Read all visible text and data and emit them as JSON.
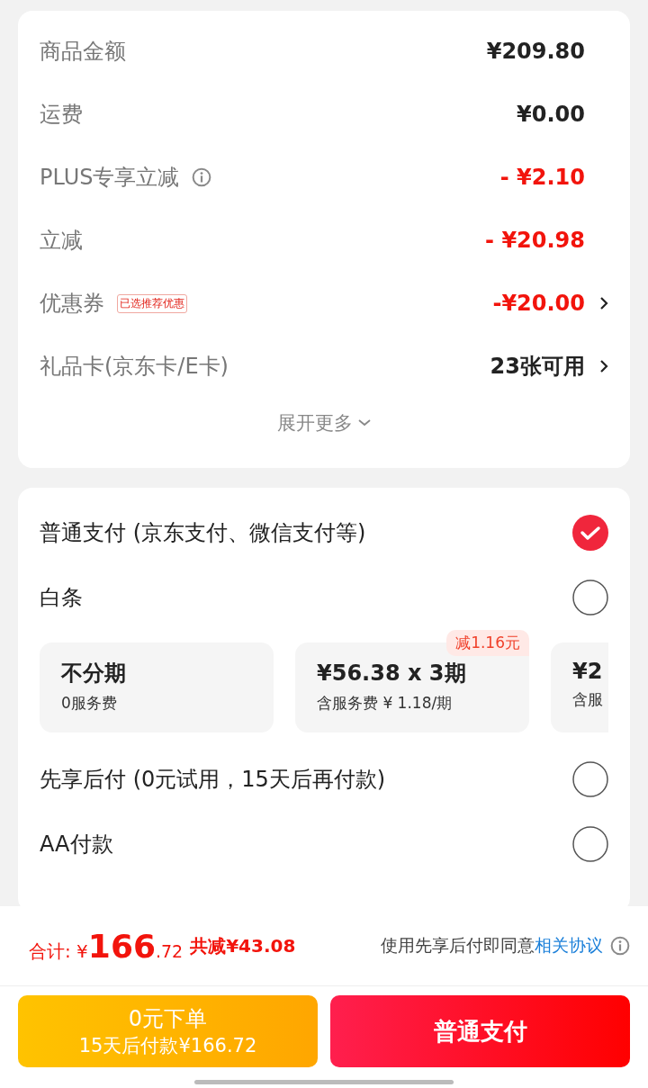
{
  "summary": {
    "rows": [
      {
        "label": "商品金额",
        "value": "¥209.80",
        "kind": "plain",
        "info": false,
        "chevron": false
      },
      {
        "label": "运费",
        "value": "¥0.00",
        "kind": "plain",
        "info": false,
        "chevron": false
      },
      {
        "label": "PLUS专享立减",
        "value": "- ¥2.10",
        "kind": "discount",
        "info": true,
        "chevron": false
      },
      {
        "label": "立减",
        "value": "- ¥20.98",
        "kind": "discount",
        "info": false,
        "chevron": false
      },
      {
        "label": "优惠券",
        "tag": "已选推荐优惠",
        "value": "-¥20.00",
        "kind": "discount",
        "info": false,
        "chevron": true
      },
      {
        "label": "礼品卡(京东卡/E卡)",
        "value": "23张可用",
        "kind": "plain",
        "info": false,
        "chevron": true
      }
    ],
    "expand": "展开更多"
  },
  "payment": {
    "options": [
      {
        "label": "普通支付 (京东支付、微信支付等)",
        "selected": true
      },
      {
        "label": "白条",
        "selected": false,
        "installments": [
          {
            "title": "不分期",
            "subtitle": "0服务费"
          },
          {
            "title": "¥56.38 x 3期",
            "subtitle": "含服务费 ¥ 1.18/期",
            "badge": "减1.16元"
          },
          {
            "title": "¥2",
            "subtitle": "含服"
          }
        ]
      },
      {
        "label": "先享后付 (0元试用，15天后再付款)",
        "selected": false
      },
      {
        "label": "AA付款",
        "selected": false
      }
    ]
  },
  "footer": {
    "total_label": "合计:",
    "currency": "¥",
    "total_int": "166",
    "total_dec": ".72",
    "saved": "共减¥43.08",
    "agreement": "使用先享后付即同意",
    "agreement_link": "相关协议",
    "buttons": [
      {
        "kind": "later",
        "title": "0元下单",
        "subtitle": "15天后付款¥166.72"
      },
      {
        "kind": "pay",
        "title": "普通支付"
      }
    ]
  }
}
